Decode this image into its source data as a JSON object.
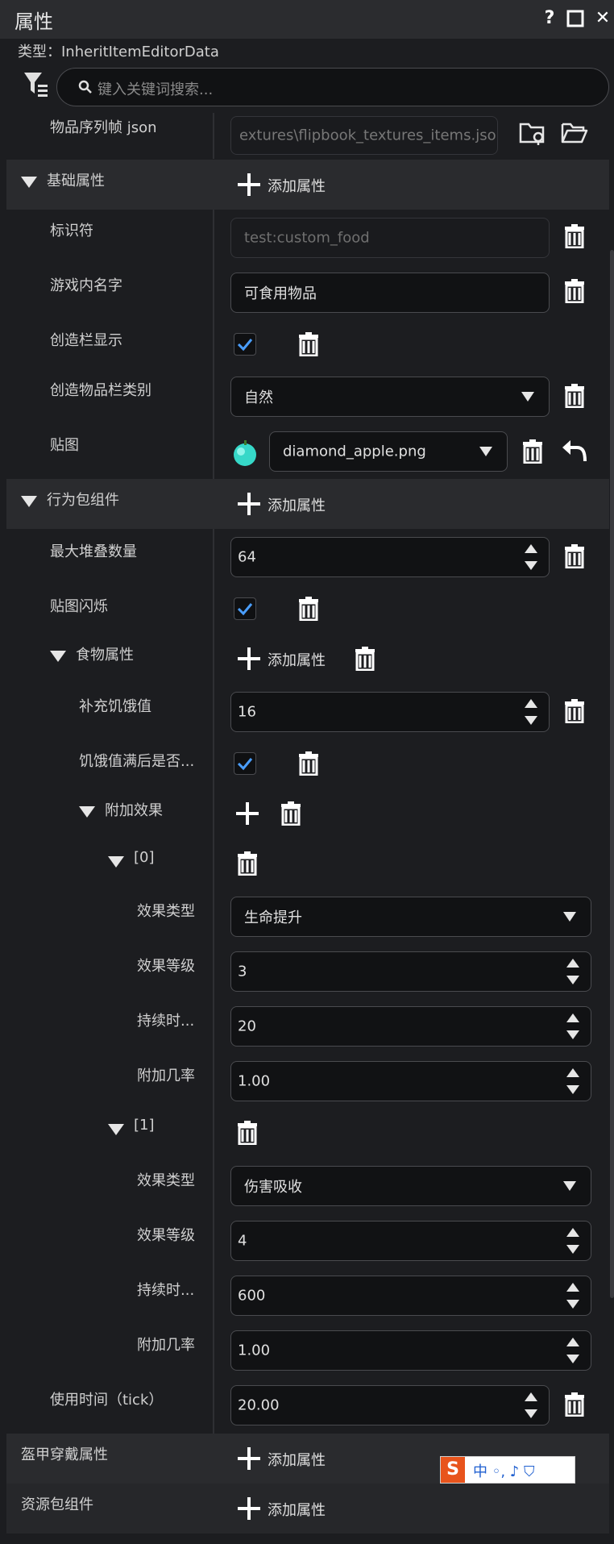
{
  "window": {
    "title": "属性",
    "help": "?",
    "maximize": "□",
    "close": "✕"
  },
  "type_line": "类型：InheritItemEditorData",
  "search": {
    "placeholder": "键入关键词搜索..."
  },
  "flipbook": {
    "label": "物品序列帧 json",
    "value": "extures\\flipbook_textures_items.json"
  },
  "basic": {
    "header": "基础属性",
    "add": "添加属性",
    "id_label": "标识符",
    "id_value": "test:custom_food",
    "name_label": "游戏内名字",
    "name_value": "可食用物品",
    "show_label": "创造栏显示",
    "show_checked": true,
    "category_label": "创造物品栏类别",
    "category_value": "自然",
    "texture_label": "贴图",
    "texture_value": "diamond_apple.png"
  },
  "behavior": {
    "header": "行为包组件",
    "add": "添加属性",
    "max_stack_label": "最大堆叠数量",
    "max_stack_value": "64",
    "glint_label": "贴图闪烁",
    "glint_checked": true,
    "food": {
      "header": "食物属性",
      "add": "添加属性",
      "nutrition_label": "补充饥饿值",
      "nutrition_value": "16",
      "always_label": "饥饿值满后是否...",
      "always_checked": true,
      "effects_header": "附加效果",
      "effects": [
        {
          "index": "[0]",
          "type_label": "效果类型",
          "type_value": "生命提升",
          "level_label": "效果等级",
          "level_value": "3",
          "duration_label": "持续时...",
          "duration_value": "20",
          "chance_label": "附加几率",
          "chance_value": "1.00"
        },
        {
          "index": "[1]",
          "type_label": "效果类型",
          "type_value": "伤害吸收",
          "level_label": "效果等级",
          "level_value": "4",
          "duration_label": "持续时...",
          "duration_value": "600",
          "chance_label": "附加几率",
          "chance_value": "1.00"
        }
      ]
    },
    "use_time_label": "使用时间（tick）",
    "use_time_value": "20.00"
  },
  "armor": {
    "header": "盔甲穿戴属性",
    "add": "添加属性"
  },
  "resource": {
    "header": "资源包组件",
    "add": "添加属性"
  },
  "ime": {
    "letter": "S",
    "text": "中 ◦, ♪ ⛉"
  },
  "colors": {
    "accent_check": "#4a9eff",
    "bg": "#1c1d20",
    "section": "#2a2b2e"
  }
}
